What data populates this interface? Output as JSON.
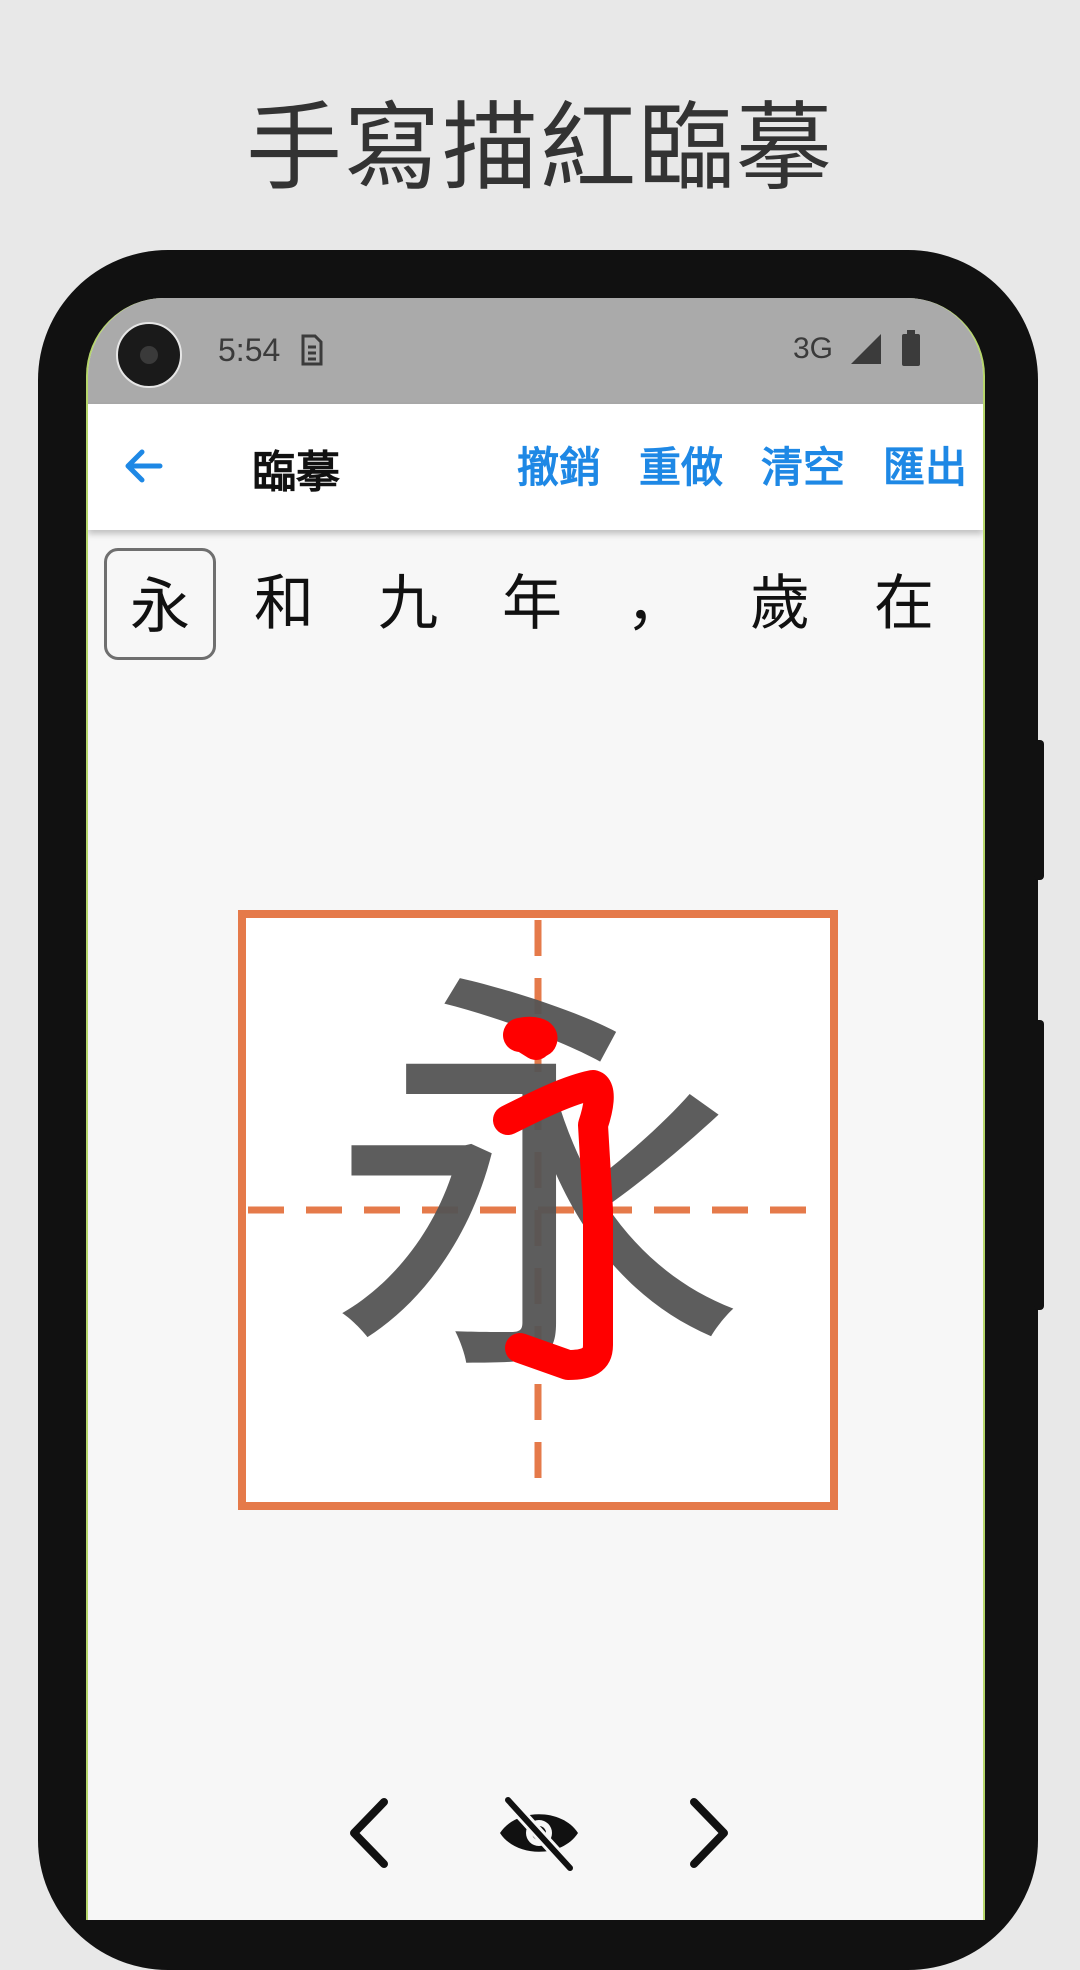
{
  "headline": "手寫描紅臨摹",
  "status_bar": {
    "time": "5:54",
    "network": "3G",
    "icons": [
      "sim-icon",
      "signal-icon",
      "battery-icon"
    ]
  },
  "toolbar": {
    "back_icon": "arrow-back-icon",
    "title": "臨摹",
    "undo": "撤銷",
    "redo": "重做",
    "clear": "清空",
    "export": "匯出"
  },
  "characters": [
    "永",
    "和",
    "九",
    "年",
    "，",
    "歲",
    "在"
  ],
  "selected_index": 0,
  "practice": {
    "guide_character": "永",
    "grid_color": "#e57a4a",
    "guide_color": "#555555",
    "stroke_color": "#ff0000"
  },
  "bottom_nav": {
    "prev_icon": "chevron-left-icon",
    "toggle_icon": "eye-off-icon",
    "next_icon": "chevron-right-icon"
  },
  "colors": {
    "accent": "#1e88e5",
    "status_bar": "#aaaaaa",
    "background": "#e8e8e8"
  }
}
